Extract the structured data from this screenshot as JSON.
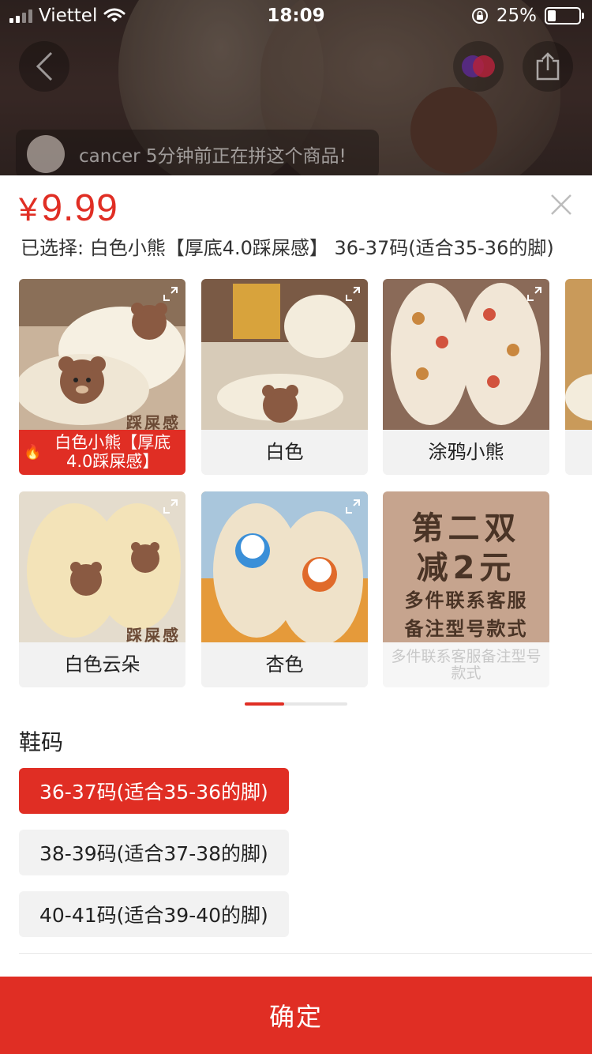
{
  "status_bar": {
    "carrier": "Viettel",
    "time": "18:09",
    "battery": "25%"
  },
  "banner": {
    "text": "cancer 5分钟前正在拼这个商品!"
  },
  "sheet": {
    "currency": "¥",
    "price": "9.99",
    "selected_text": "已选择: 白色小熊【厚底4.0踩屎感】 36-37码(适合35-36的脚)",
    "variants": [
      {
        "label": "白色小熊【厚底4.0踩屎感】",
        "selected": true,
        "hot": true
      },
      {
        "label": "白色",
        "selected": false
      },
      {
        "label": "涂鸦小熊",
        "selected": false
      },
      {
        "label": "",
        "selected": false
      },
      {
        "label": "白色云朵",
        "selected": false
      },
      {
        "label": "杏色",
        "selected": false
      },
      {
        "label": "多件联系客服备注型号款式",
        "selected": false,
        "disabled": true
      }
    ],
    "image_texts": {
      "feel_tag": "踩屎感",
      "promo_line1": "第二双",
      "promo_line2": "减2元",
      "promo_line3": "多件联系客服",
      "promo_line4": "备注型号款式"
    },
    "size_title": "鞋码",
    "sizes": [
      {
        "label": "36-37码(适合35-36的脚)",
        "selected": true
      },
      {
        "label": "38-39码(适合37-38的脚)",
        "selected": false
      },
      {
        "label": "40-41码(适合39-40的脚)",
        "selected": false
      }
    ],
    "confirm_label": "确定"
  },
  "colors": {
    "accent": "#e02e24",
    "chip_bg": "#f2f2f2",
    "text": "#222222"
  }
}
